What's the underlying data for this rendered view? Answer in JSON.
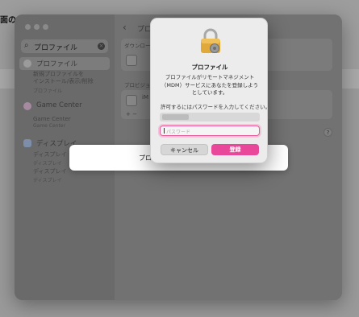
{
  "background": {
    "title": "面の纟"
  },
  "sidebar": {
    "search": {
      "value": "プロファイル"
    },
    "items": [
      {
        "label": "プロファイル",
        "sub": "新規プロファイルを\nインストール/表示/削除",
        "sub2": "プロファイル"
      },
      {
        "label": "Game Center",
        "sub": "Game Center",
        "sub2": "Game Center"
      },
      {
        "label": "ディスプレイ",
        "sub": "ディスプレイ",
        "sub2": "ディスプレイ",
        "sub3": "ディスプレイ",
        "sub4": "ディスプレイ"
      }
    ]
  },
  "content": {
    "title": "プロ",
    "group1_label": "ダウンロー",
    "group2_label": "プロビジョ",
    "row_text": "iM",
    "add_remove": "+ −"
  },
  "sheet": {
    "text": "プロ"
  },
  "dialog": {
    "title": "プロファイル",
    "message": "プロファイルがリモートマネジメント（MDM）サービスにあなたを登録しようとしています。",
    "prompt": "許可するにはパスワードを入力してください。",
    "password_placeholder": "パスワード",
    "cancel_label": "キャンセル",
    "register_label": "登録"
  },
  "help": {
    "label": "?"
  },
  "colors": {
    "accent": "#e8479a"
  }
}
